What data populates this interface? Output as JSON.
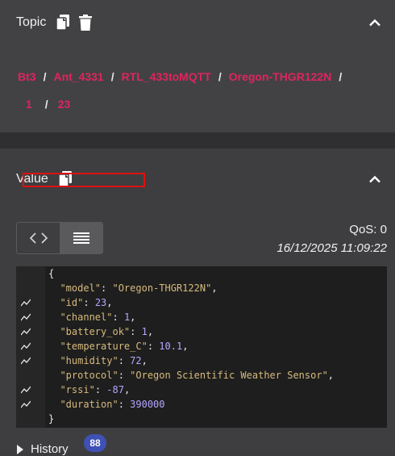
{
  "topic": {
    "title": "Topic",
    "copy_icon": "copy-icon",
    "delete_icon": "trash-icon",
    "collapse_icon": "chevron-up-icon",
    "crumbs": [
      "Bt3",
      "Ant_4331",
      "RTL_433toMQTT",
      "Oregon-THGR122N",
      "1",
      "23"
    ],
    "separator": "/"
  },
  "value": {
    "title": "Value",
    "copy_icon": "copy-icon",
    "collapse_icon": "chevron-up-icon",
    "qos": "QoS: 0",
    "timestamp": "16/12/2025 11:09:22",
    "view_toggle": {
      "code_icon": "code-view-icon",
      "list_icon": "list-view-icon",
      "active": "list"
    },
    "json_lines": [
      {
        "parts": [
          [
            "p",
            "{"
          ]
        ],
        "spark": false
      },
      {
        "parts": [
          [
            "k",
            "\"model\""
          ],
          [
            "p",
            ": "
          ],
          [
            "s",
            "\"Oregon-THGR122N\""
          ],
          [
            "p",
            ","
          ]
        ],
        "spark": false
      },
      {
        "parts": [
          [
            "k",
            "\"id\""
          ],
          [
            "p",
            ": "
          ],
          [
            "n",
            "23"
          ],
          [
            "p",
            ","
          ]
        ],
        "spark": true
      },
      {
        "parts": [
          [
            "k",
            "\"channel\""
          ],
          [
            "p",
            ": "
          ],
          [
            "n",
            "1"
          ],
          [
            "p",
            ","
          ]
        ],
        "spark": true
      },
      {
        "parts": [
          [
            "k",
            "\"battery_ok\""
          ],
          [
            "p",
            ": "
          ],
          [
            "n",
            "1"
          ],
          [
            "p",
            ","
          ]
        ],
        "spark": true
      },
      {
        "parts": [
          [
            "k",
            "\"temperature_C\""
          ],
          [
            "p",
            ": "
          ],
          [
            "n",
            "10.1"
          ],
          [
            "p",
            ","
          ]
        ],
        "spark": true
      },
      {
        "parts": [
          [
            "k",
            "\"humidity\""
          ],
          [
            "p",
            ": "
          ],
          [
            "n",
            "72"
          ],
          [
            "p",
            ","
          ]
        ],
        "spark": true
      },
      {
        "parts": [
          [
            "k",
            "\"protocol\""
          ],
          [
            "p",
            ": "
          ],
          [
            "s",
            "\"Oregon Scientific Weather Sensor\""
          ],
          [
            "p",
            ","
          ]
        ],
        "spark": false
      },
      {
        "parts": [
          [
            "k",
            "\"rssi\""
          ],
          [
            "p",
            ": "
          ],
          [
            "n",
            "-87"
          ],
          [
            "p",
            ","
          ]
        ],
        "spark": true
      },
      {
        "parts": [
          [
            "k",
            "\"duration\""
          ],
          [
            "p",
            ": "
          ],
          [
            "n",
            "390000"
          ]
        ],
        "spark": true
      },
      {
        "parts": [
          [
            "p",
            "}"
          ]
        ],
        "spark": false
      }
    ]
  },
  "history": {
    "label": "History",
    "count": "88",
    "expand_icon": "triangle-right-icon"
  },
  "colors": {
    "link": "#e0245e",
    "badge": "#3f51b5",
    "highlight": "#e01010"
  }
}
